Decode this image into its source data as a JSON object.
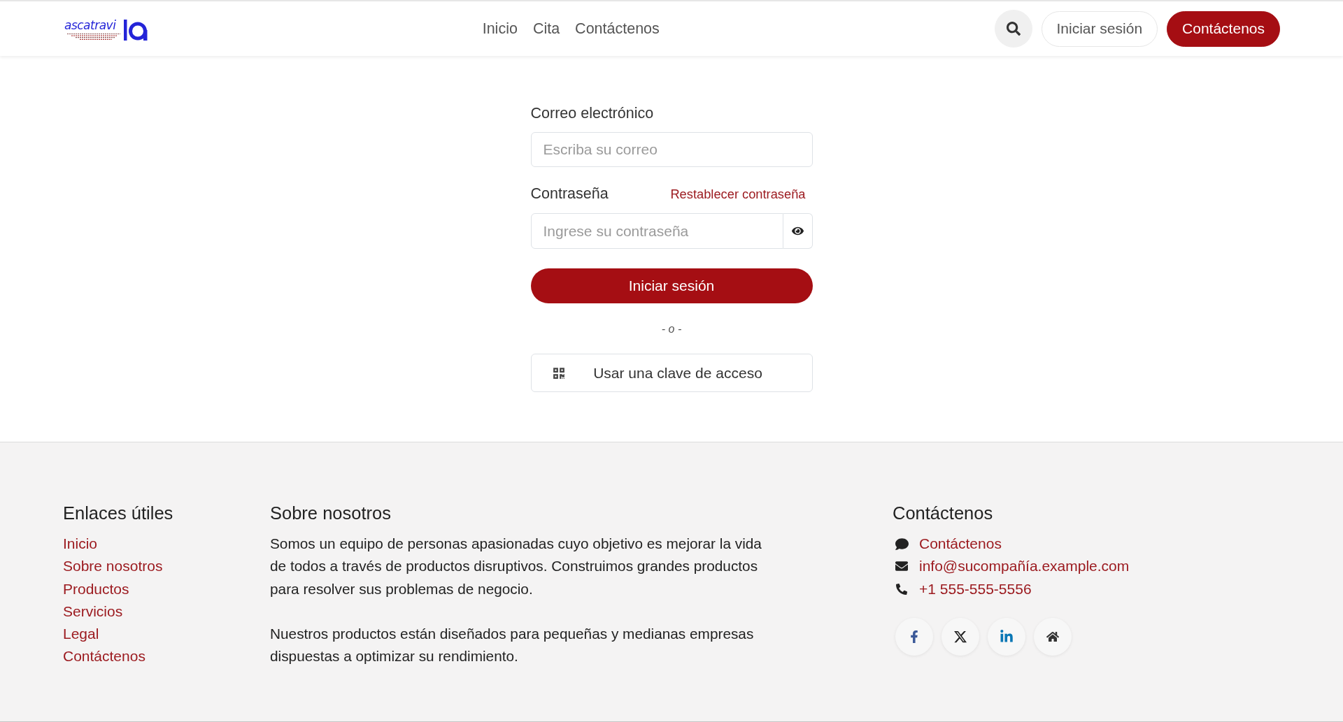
{
  "header": {
    "logo": {
      "text": "ascatravi"
    },
    "nav": [
      {
        "label": "Inicio"
      },
      {
        "label": "Cita"
      },
      {
        "label": "Contáctenos"
      }
    ],
    "login_button": "Iniciar sesión",
    "contact_button": "Contáctenos"
  },
  "login_form": {
    "email": {
      "label": "Correo electrónico",
      "placeholder": "Escriba su correo"
    },
    "password": {
      "label": "Contraseña",
      "reset_link": "Restablecer contraseña",
      "placeholder": "Ingrese su contraseña"
    },
    "submit_button": "Iniciar sesión",
    "separator": "- o -",
    "passkey_button": "Usar una clave de acceso"
  },
  "footer": {
    "links": {
      "title": "Enlaces útiles",
      "items": [
        "Inicio",
        "Sobre nosotros",
        "Productos",
        "Servicios",
        "Legal",
        "Contáctenos"
      ]
    },
    "about": {
      "title": "Sobre nosotros",
      "paragraphs": [
        "Somos un equipo de personas apasionadas cuyo objetivo es mejorar la vida de todos a través de productos disruptivos. Construimos grandes productos para resolver sus problemas de negocio.",
        "Nuestros productos están diseñados para pequeñas y medianas empresas dispuestas a optimizar su rendimiento."
      ]
    },
    "contact": {
      "title": "Contáctenos",
      "items": [
        {
          "kind": "chat",
          "text": "Contáctenos"
        },
        {
          "kind": "email",
          "text": "info@sucompañía.example.com"
        },
        {
          "kind": "phone",
          "text": "+1 555-555-5556"
        }
      ],
      "social": [
        {
          "kind": "facebook"
        },
        {
          "kind": "x"
        },
        {
          "kind": "linkedin"
        },
        {
          "kind": "home"
        }
      ]
    }
  }
}
